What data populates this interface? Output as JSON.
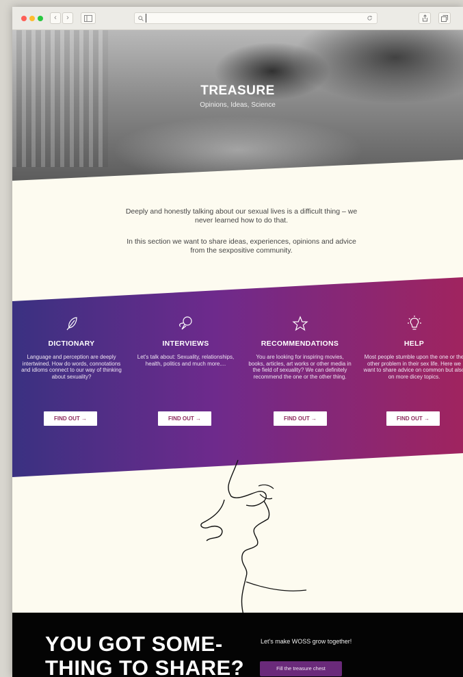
{
  "browser": {
    "dots": [
      "#fe5f57",
      "#febc2e",
      "#28c840"
    ],
    "url_value": ""
  },
  "hero": {
    "title": "TREASURE",
    "subtitle": "Opinions, Ideas, Science"
  },
  "intro": {
    "p1": "Deeply and honestly talking about our sexual lives is a difficult thing – we never learned how to do that.",
    "p2": "In this section we want to share ideas, experiences, opinions and advice from the sexpositive community."
  },
  "features": [
    {
      "title": "DICTIONARY",
      "icon": "feather-icon",
      "text": "Language and perception are deeply intertwined. How do words, connotations and idioms connect to our way of thinking about sexuality?",
      "button": "FIND OUT →"
    },
    {
      "title": "INTERVIEWS",
      "icon": "speech-bubbles-icon",
      "text": "Let's talk about: Sexuality, relationships, health, politics and much more....",
      "button": "FIND OUT →"
    },
    {
      "title": "RECOMMENDATIONS",
      "icon": "star-icon",
      "text": "You are looking for inspiring movies, books, articles, art works or other media in the field of sexuality? We can definitely recommend the one or the other thing.",
      "button": "FIND OUT →"
    },
    {
      "title": "HELP",
      "icon": "lightbulb-icon",
      "text": "Most people stumble upon the one or the other problem in their sex life. Here we want to share advice on common but also on more dicey topics.",
      "button": "FIND OUT →"
    }
  ],
  "share": {
    "heading_line1": "YOU GOT SOME-",
    "heading_line2": "THING TO SHARE?",
    "tagline": "Let's make WOSS grow together!",
    "button": "Fill the treasure chest"
  },
  "colors": {
    "band_start": "#3a3181",
    "band_end": "#a0245f",
    "accent": "#8c2a5c",
    "page_bg": "#fdfbf0"
  }
}
